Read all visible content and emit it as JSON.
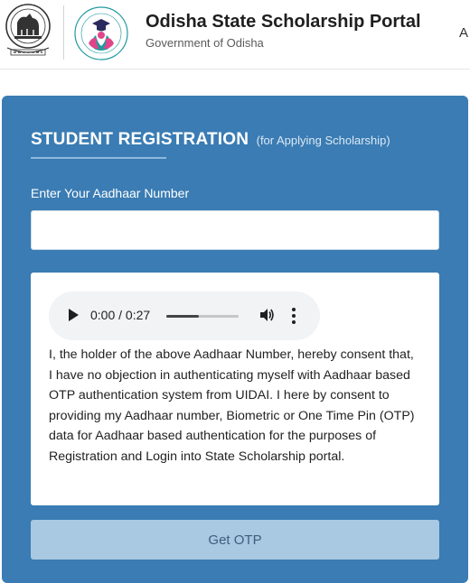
{
  "header": {
    "title": "Odisha State Scholarship Portal",
    "subtitle": "Government of Odisha",
    "nav_partial": "A"
  },
  "registration": {
    "title": "STUDENT REGISTRATION",
    "title_note": "(for Applying Scholarship)",
    "aadhaar_label": "Enter Your Aadhaar Number",
    "aadhaar_value": "",
    "audio": {
      "time": "0:00 / 0:27",
      "progress_fraction": 0.45
    },
    "consent_text": "I, the holder of the above Aadhaar Number, hereby consent that, I have no objection in authenticating myself with Aadhaar based OTP authentication system from UIDAI. I here by consent to providing my Aadhaar number, Biometric or One Time Pin (OTP) data for Aadhaar based authentication for the purposes of Registration and Login into State Scholarship portal.",
    "otp_button": "Get OTP"
  },
  "colors": {
    "card_bg": "#3a7cb3",
    "button_bg": "#a9c8e2",
    "accent_teal": "#1f9aa0",
    "accent_pink": "#e0458a"
  },
  "icons": [
    "odisha-emblem-icon",
    "scholarship-logo-icon",
    "play-icon",
    "volume-icon",
    "more-options-icon"
  ]
}
